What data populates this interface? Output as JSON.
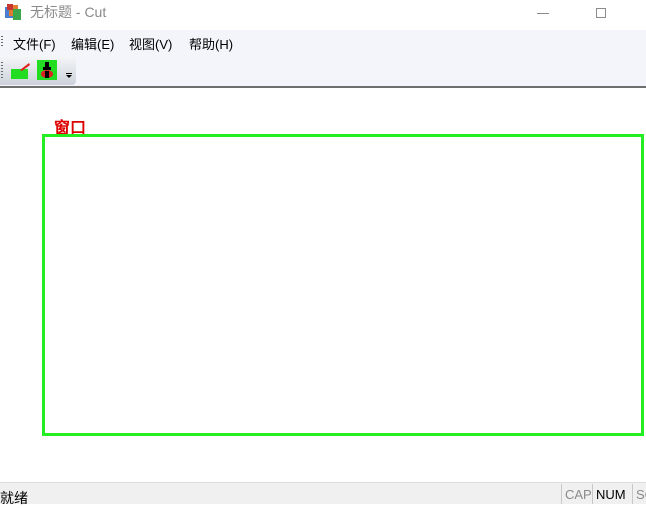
{
  "window": {
    "title": "无标题 - Cut",
    "app_icon": "app-icon",
    "minimize_icon": "minimize-icon",
    "maximize_icon": "maximize-icon"
  },
  "menu": {
    "items": [
      {
        "label": "文件(F)"
      },
      {
        "label": "编辑(E)"
      },
      {
        "label": "视图(V)"
      },
      {
        "label": "帮助(H)"
      }
    ]
  },
  "toolbar": {
    "buttons": [
      {
        "icon": "cut-icon"
      },
      {
        "icon": "paint-icon"
      }
    ],
    "overflow_icon": "toolbar-overflow-icon"
  },
  "canvas": {
    "label": "窗口",
    "label_color": "#dd0000",
    "rect_color": "#22ee22"
  },
  "status": {
    "text": "就绪",
    "indicators": [
      "CAP",
      "NUM",
      "SC"
    ]
  }
}
